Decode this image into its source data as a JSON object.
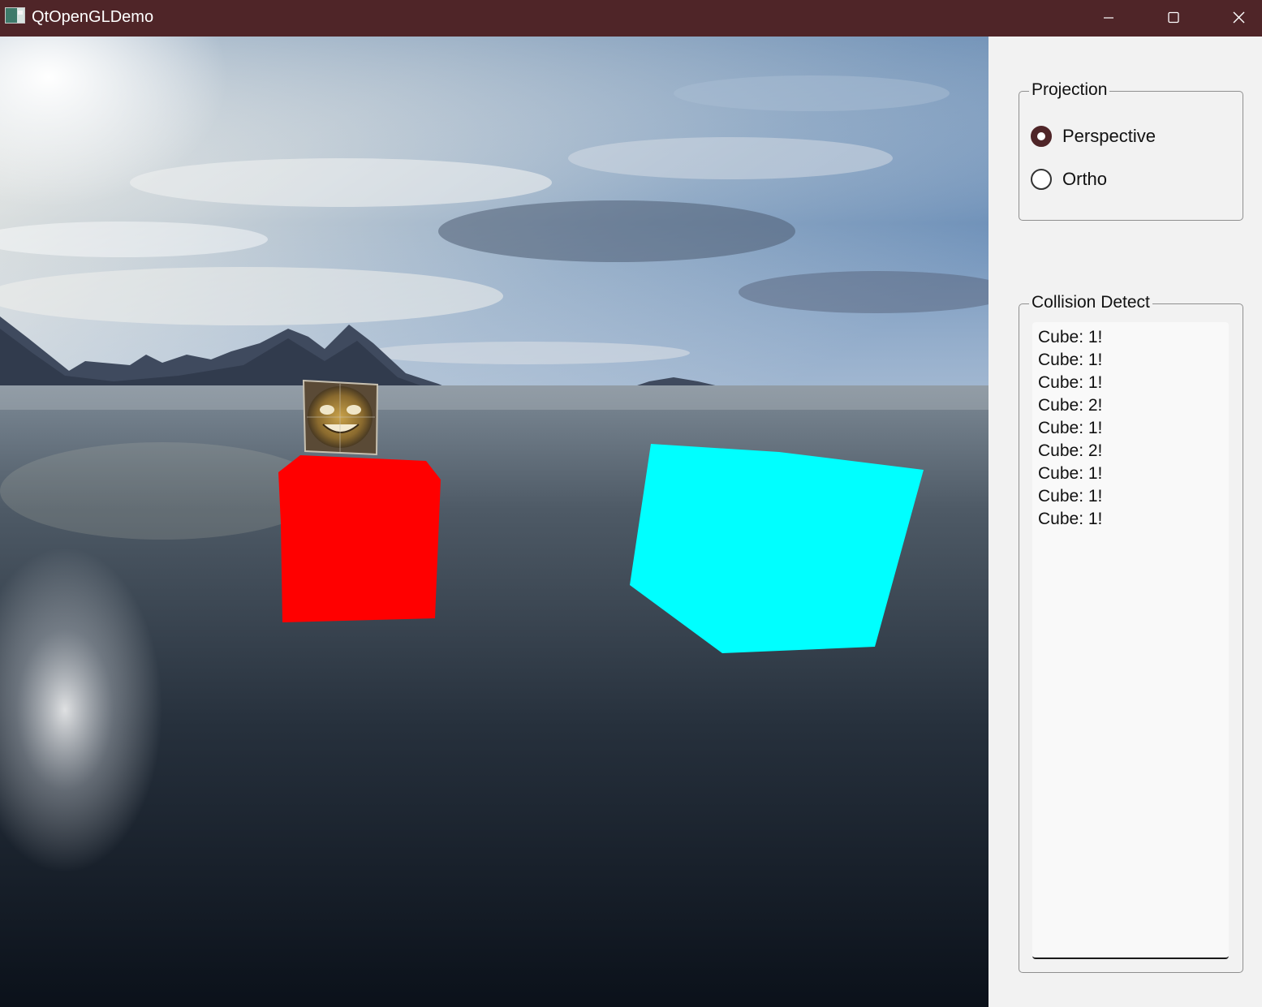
{
  "window": {
    "title": "QtOpenGLDemo"
  },
  "colors": {
    "titlebar": "#4f2528",
    "cube_red": "#ff0000",
    "cube_cyan": "#00ffff"
  },
  "scene": {
    "objects": [
      "textured-crate",
      "red-cube",
      "cyan-cube"
    ]
  },
  "projection": {
    "title": "Projection",
    "options": [
      {
        "label": "Perspective",
        "checked": true
      },
      {
        "label": "Ortho",
        "checked": false
      }
    ]
  },
  "collision": {
    "title": "Collision Detect",
    "items": [
      "Cube: 1!",
      "Cube: 1!",
      "Cube: 1!",
      "Cube: 2!",
      "Cube: 1!",
      "Cube: 2!",
      "Cube: 1!",
      "Cube: 1!",
      "Cube: 1!"
    ]
  }
}
